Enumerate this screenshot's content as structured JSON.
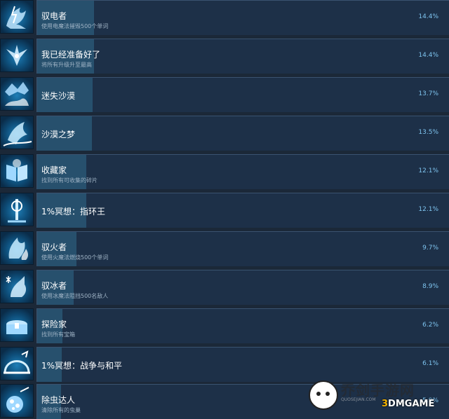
{
  "achievements": [
    {
      "title": "驭电者",
      "desc": "使用电魔法摧毁500个单词",
      "percent": "14.4%",
      "icon": "lightning-creature-icon",
      "fill": 0.14
    },
    {
      "title": "我已经准备好了",
      "desc": "将所有升级升至最高",
      "percent": "14.4%",
      "icon": "winged-beast-icon",
      "fill": 0.14
    },
    {
      "title": "迷失沙漠",
      "desc": "",
      "percent": "13.7%",
      "icon": "desert-fox-icon",
      "fill": 0.137
    },
    {
      "title": "沙漠之梦",
      "desc": "",
      "percent": "13.5%",
      "icon": "desert-dream-icon",
      "fill": 0.135
    },
    {
      "title": "收藏家",
      "desc": "找到所有可收集的碎片",
      "percent": "12.1%",
      "icon": "open-book-icon",
      "fill": 0.121
    },
    {
      "title": "1%冥想：指环王",
      "desc": "",
      "percent": "12.1%",
      "icon": "ring-totem-icon",
      "fill": 0.121
    },
    {
      "title": "驭火者",
      "desc": "使用火魔法燃烧500个单词",
      "percent": "9.7%",
      "icon": "fire-fox-icon",
      "fill": 0.097
    },
    {
      "title": "驭冰者",
      "desc": "使用冰魔法阻挡500名敌人",
      "percent": "8.9%",
      "icon": "ice-fox-icon",
      "fill": 0.089
    },
    {
      "title": "探险家",
      "desc": "找到所有宝箱",
      "percent": "6.2%",
      "icon": "treasure-chest-icon",
      "fill": 0.062
    },
    {
      "title": "1%冥想：战争与和平",
      "desc": "",
      "percent": "6.1%",
      "icon": "dome-icon",
      "fill": 0.061
    },
    {
      "title": "除虫达人",
      "desc": "清除所有的虫巢",
      "percent": "5.9%",
      "icon": "bug-nest-icon",
      "fill": 0.059
    }
  ],
  "watermark": {
    "site_name": "乔剑手游网",
    "site_url": "QUOSEJIAN.COM",
    "logo_number": "3",
    "logo_text": "DMGAME"
  },
  "colors": {
    "background": "#1b2838",
    "card": "#1d3048",
    "progress": "#27506d",
    "percent_text": "#7ec4ef"
  }
}
